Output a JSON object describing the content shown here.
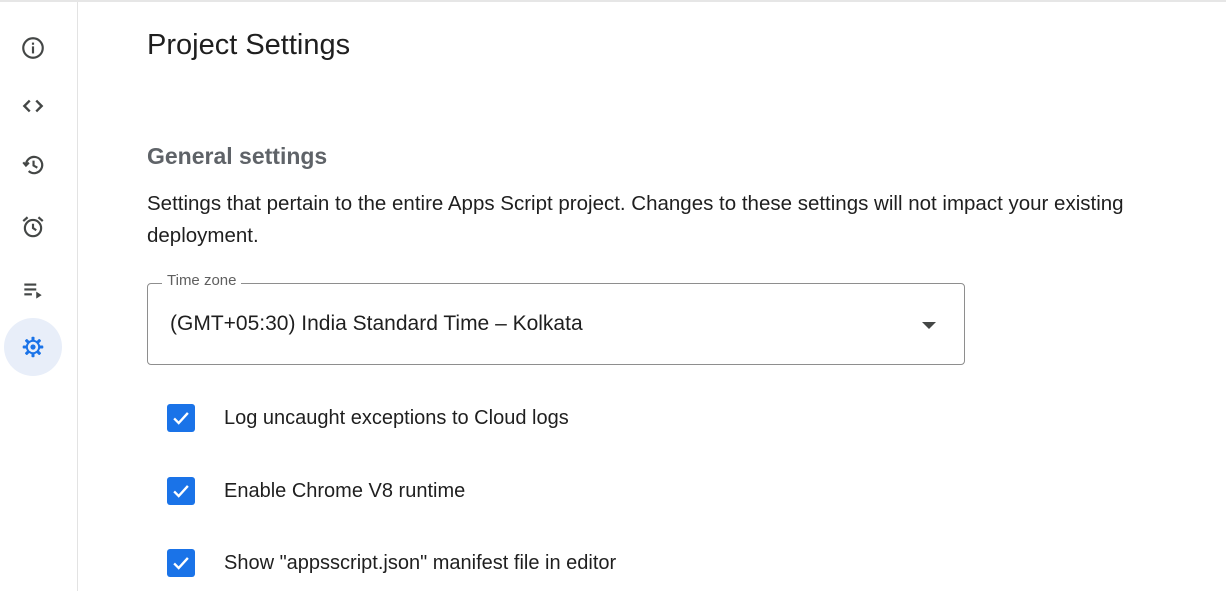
{
  "page": {
    "title": "Project Settings"
  },
  "sidebar": {
    "items": [
      {
        "name": "overview",
        "icon": "info-icon",
        "active": false
      },
      {
        "name": "editor",
        "icon": "code-icon",
        "active": false
      },
      {
        "name": "project-history",
        "icon": "history-icon",
        "active": false
      },
      {
        "name": "triggers",
        "icon": "alarm-clock-icon",
        "active": false
      },
      {
        "name": "executions",
        "icon": "playlist-play-icon",
        "active": false
      },
      {
        "name": "project-settings",
        "icon": "gear-icon",
        "active": true
      }
    ]
  },
  "general": {
    "title": "General settings",
    "description": "Settings that pertain to the entire Apps Script project. Changes to these settings will not impact your existing deployment.",
    "timezone": {
      "label": "Time zone",
      "value": "(GMT+05:30) India Standard Time – Kolkata"
    },
    "options": [
      {
        "label": "Log uncaught exceptions to Cloud logs",
        "checked": true
      },
      {
        "label": "Enable Chrome V8 runtime",
        "checked": true
      },
      {
        "label": "Show \"appsscript.json\" manifest file in editor",
        "checked": true
      }
    ]
  },
  "colors": {
    "accent": "#1a73e8",
    "active_rail_bg": "#e8eef9",
    "icon": "#444746",
    "section_title": "#5f6368"
  }
}
